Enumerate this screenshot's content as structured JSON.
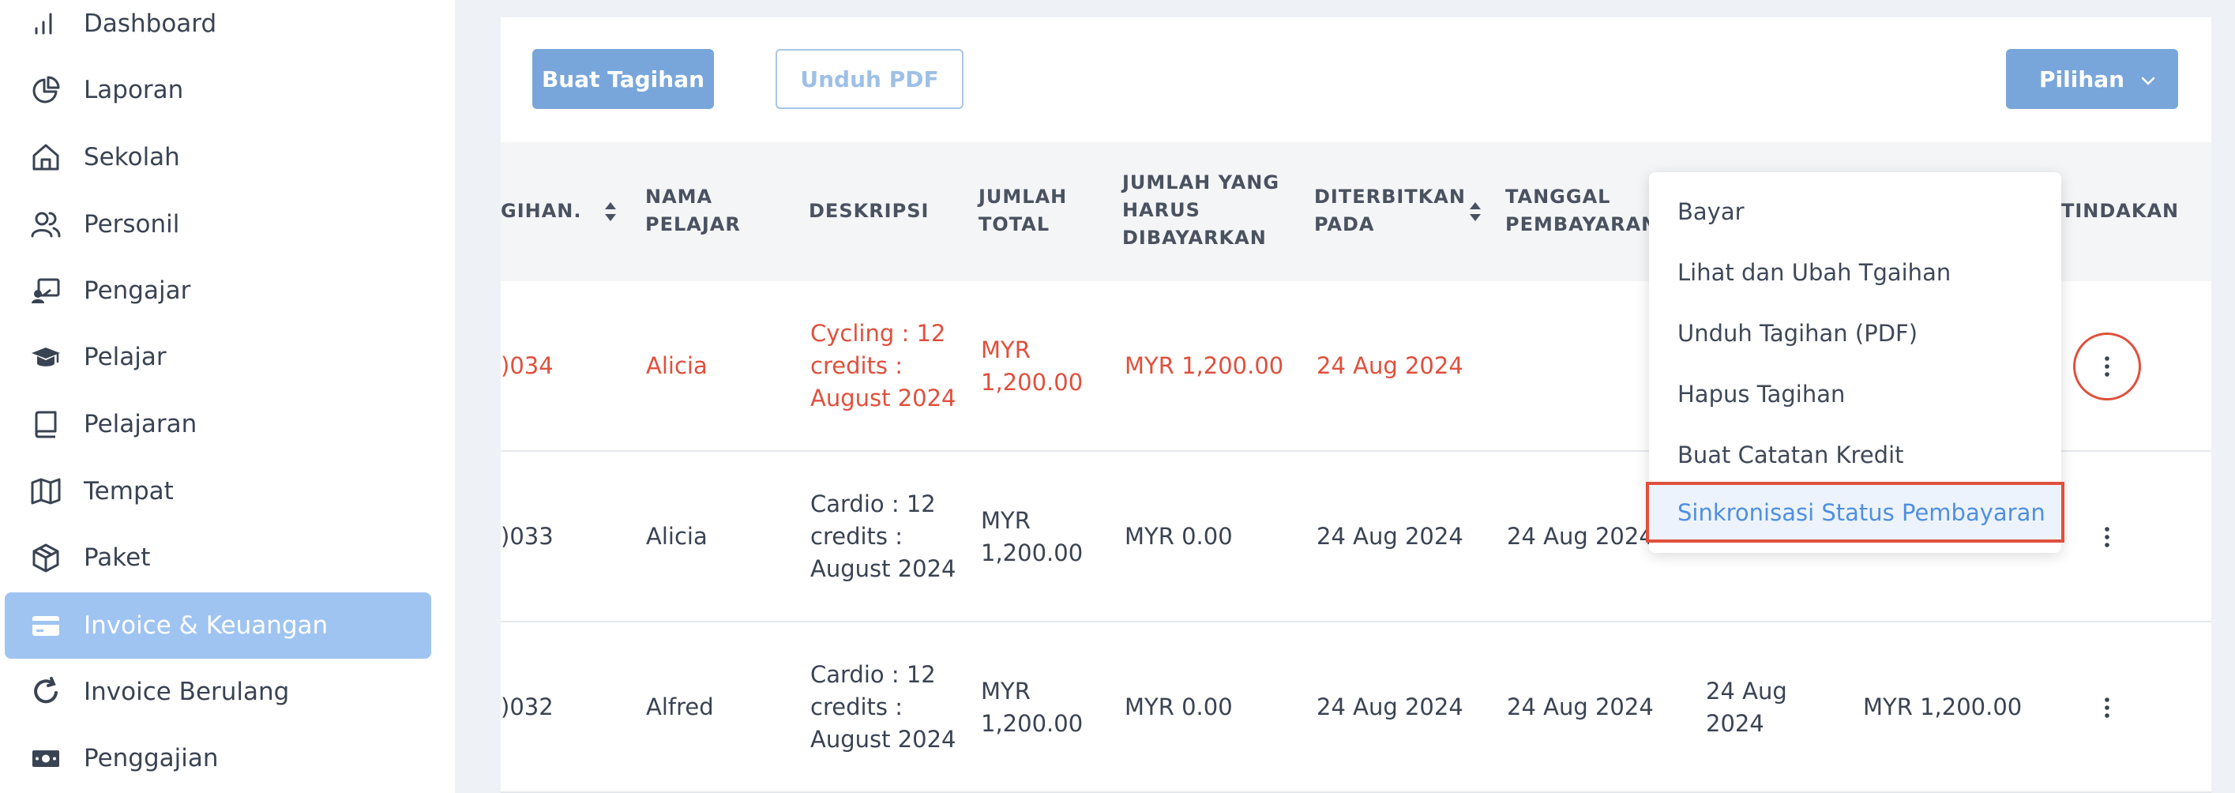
{
  "sidebar": {
    "items": [
      {
        "label": "Dashboard",
        "icon": "bar-chart-icon"
      },
      {
        "label": "Laporan",
        "icon": "pie-chart-icon"
      },
      {
        "label": "Sekolah",
        "icon": "home-icon"
      },
      {
        "label": "Personil",
        "icon": "users-icon"
      },
      {
        "label": "Pengajar",
        "icon": "teacher-icon"
      },
      {
        "label": "Pelajar",
        "icon": "graduation-cap-icon"
      },
      {
        "label": "Pelajaran",
        "icon": "book-icon"
      },
      {
        "label": "Tempat",
        "icon": "map-icon"
      },
      {
        "label": "Paket",
        "icon": "package-icon"
      },
      {
        "label": "Invoice & Keuangan",
        "icon": "credit-card-icon",
        "active": true
      },
      {
        "label": "Invoice Berulang",
        "icon": "refresh-icon"
      },
      {
        "label": "Penggajian",
        "icon": "money-icon"
      }
    ]
  },
  "toolbar": {
    "create_invoice": "Buat Tagihan",
    "download_pdf": "Unduh PDF",
    "options": "Pilihan"
  },
  "table": {
    "columns": {
      "invoice_no": "GIHAN.",
      "student_1": "NAMA",
      "student_2": "PELAJAR",
      "description": "DESKRIPSI",
      "total_1": "JUMLAH",
      "total_2": "TOTAL",
      "due_1": "JUMLAH YANG",
      "due_2": "HARUS",
      "due_3": "DIBAYARKAN",
      "issued_1": "DITERBITKAN",
      "issued_2": "PADA",
      "paydate_1": "TANGGAL",
      "paydate_2": "PEMBAYARAN",
      "action": "TINDAKAN"
    },
    "rows": [
      {
        "no": ")034",
        "student": "Alicia",
        "desc_1": "Cycling : 12",
        "desc_2": "credits :",
        "desc_3": "August 2024",
        "total_1": "MYR",
        "total_2": "1,200.00",
        "due": "MYR 1,200.00",
        "issued": "24 Aug 2024",
        "paydate": "",
        "status": "overdue"
      },
      {
        "no": ")033",
        "student": "Alicia",
        "desc_1": "Cardio : 12",
        "desc_2": "credits :",
        "desc_3": "August 2024",
        "total_1": "MYR",
        "total_2": "1,200.00",
        "due": "MYR 0.00",
        "issued": "24 Aug 2024",
        "paydate": "24 Aug 2024"
      },
      {
        "no": ")032",
        "student": "Alfred",
        "desc_1": "Cardio : 12",
        "desc_2": "credits :",
        "desc_3": "August 2024",
        "total_1": "MYR",
        "total_2": "1,200.00",
        "due": "MYR 0.00",
        "issued": "24 Aug 2024",
        "paydate": "24 Aug 2024",
        "extra_date_1": "24 Aug",
        "extra_date_2": "2024",
        "extra_amount": "MYR 1,200.00"
      }
    ]
  },
  "dropdown": {
    "items": [
      "Bayar",
      "Lihat dan Ubah Tgaihan",
      "Unduh Tagihan (PDF)",
      "Hapus Tagihan",
      "Buat Catatan Kredit",
      "Sinkronisasi Status Pembayaran"
    ]
  },
  "colors": {
    "primary": "#79a6da",
    "active_nav": "#9fc4f2",
    "overdue": "#e0503d",
    "highlight_text": "#4f8fe0"
  }
}
